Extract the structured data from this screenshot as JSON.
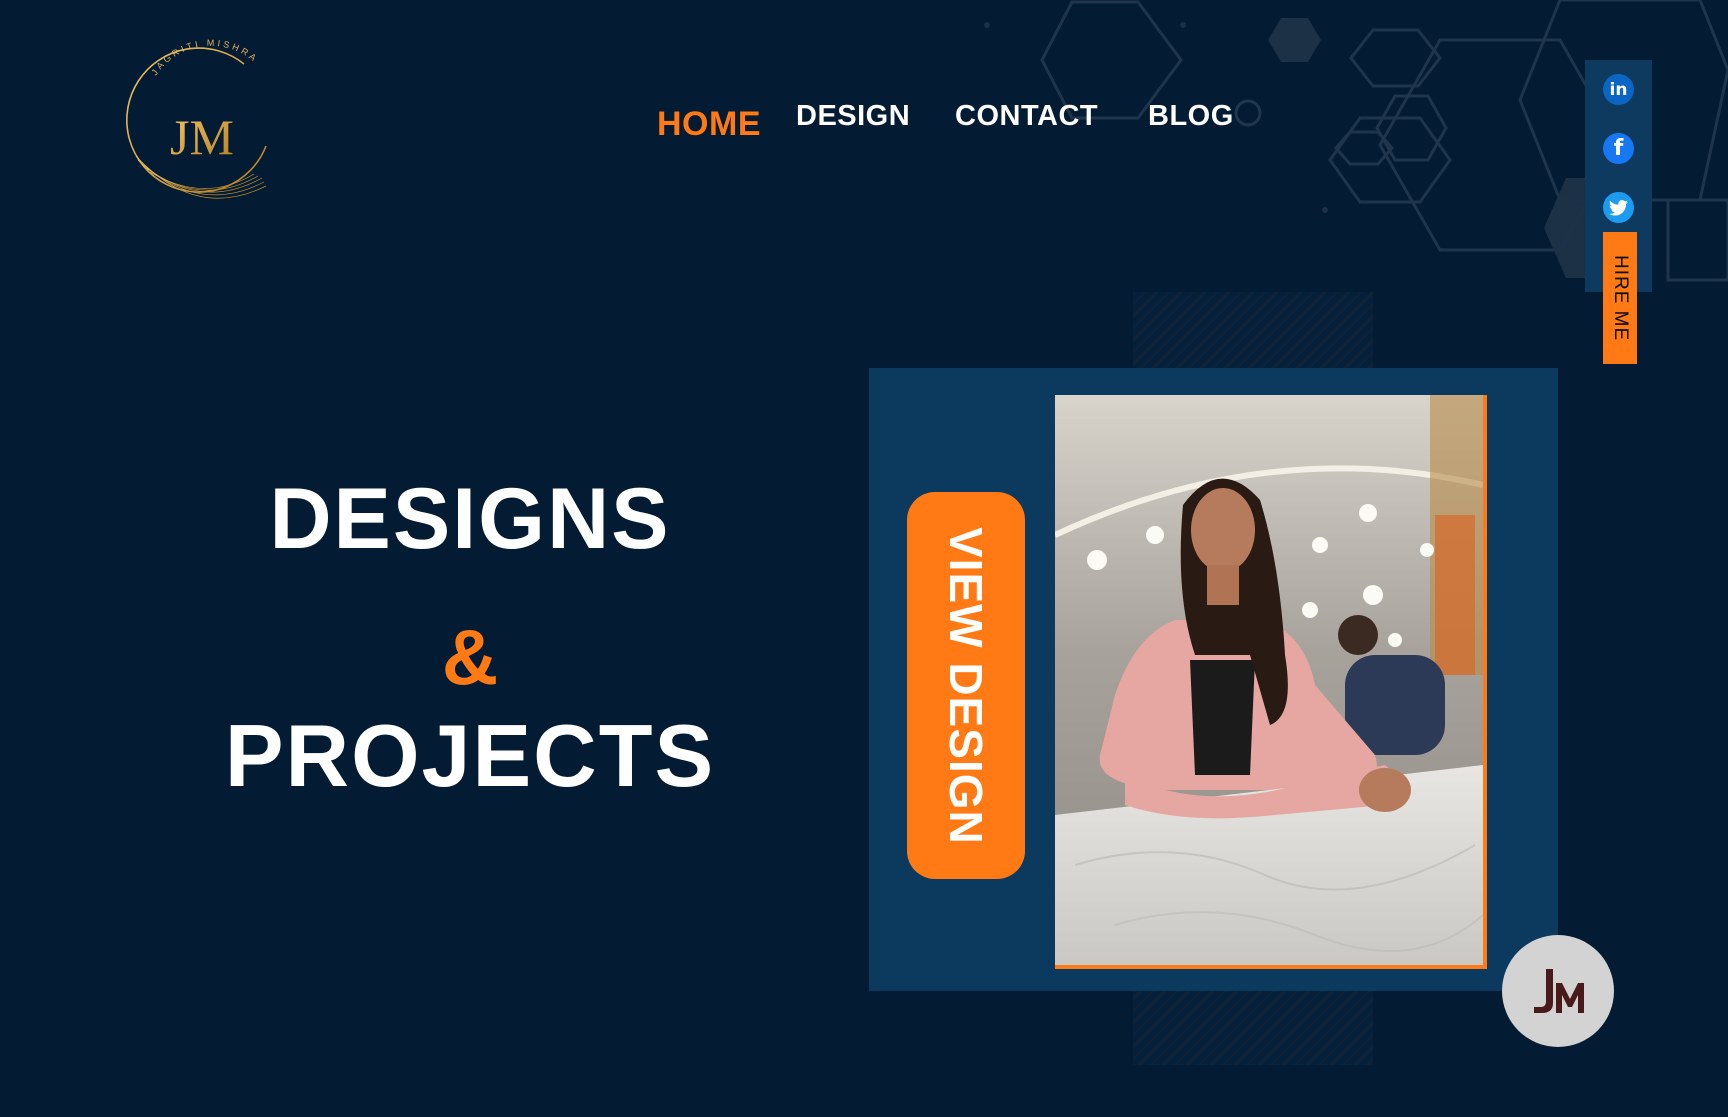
{
  "brand": {
    "name_ring": "JAGRITI MISHRA",
    "monogram": "JM"
  },
  "nav": {
    "items": [
      {
        "label": "HOME",
        "active": true
      },
      {
        "label": "DESIGN",
        "active": false
      },
      {
        "label": "CONTACT",
        "active": false
      },
      {
        "label": "BLOG",
        "active": false
      }
    ]
  },
  "social": {
    "icons": [
      "linkedin-icon",
      "facebook-icon",
      "twitter-icon"
    ],
    "hire_label": "HIRE ME"
  },
  "hero": {
    "line1": "DESIGNS",
    "line2": "&",
    "line3": "PROJECTS",
    "cta_label": "VIEW DESIGN"
  },
  "badge": {
    "monogram": "JM"
  },
  "colors": {
    "background": "#031b33",
    "accent": "#ff7a14",
    "card": "#0c3a5e",
    "gold": "#d9a441"
  }
}
